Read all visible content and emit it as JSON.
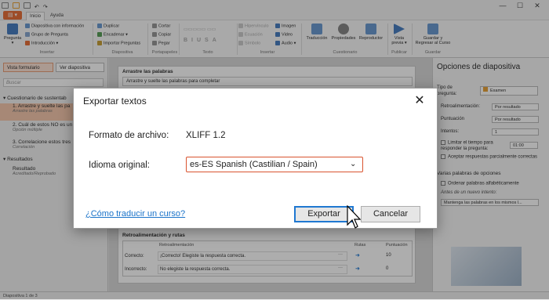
{
  "window": {
    "title": "",
    "min": "—",
    "max": "☐",
    "close": "✕"
  },
  "tabs": {
    "file": "▤ ▾",
    "items": [
      "Inicio",
      "Ayuda"
    ],
    "active": "Inicio"
  },
  "ribbon": {
    "preguntas": {
      "label": "Pregunta",
      "arrow": "▾"
    },
    "insertar_items": [
      "Diapositiva con información",
      "Grupo de Pregunta",
      "Introducción ▾"
    ],
    "insertar": "Insertar",
    "diapositiva_items": [
      "Duplicar",
      "Encadenar ▾",
      "Importar Preguntas"
    ],
    "diapositiva": "Diapositiva",
    "portapapeles_items": [
      "Cortar",
      "Copiar",
      "Pegar"
    ],
    "portapapeles": "Portapapeles",
    "texto": "Texto",
    "insertar2_items": [
      "Hipervínculo",
      "Ecuación",
      "Símbolo"
    ],
    "insertar2_media": [
      "Imagen",
      "Video",
      "Audio ▾"
    ],
    "insertar2": "Insertar",
    "cuestionario_items": [
      "Traducción",
      "Propiedades",
      "Reproductor"
    ],
    "cuestionario": "Cuestionario",
    "publicar_item": "Vista previa ▾",
    "publicar": "Publicar",
    "guardar_item": "Guardar y Regresar al Curso",
    "guardar": "Guardar"
  },
  "left": {
    "view_form": "Vista formulario",
    "view_slide": "Ver diapositiva",
    "search_placeholder": "Buscar",
    "group1": "Cuestionario de sustentab",
    "items": [
      {
        "title": "1. Arrastre y suelte las pa",
        "sub": "Arrastre las palabras"
      },
      {
        "title": "2. Cuál de estos NO es un",
        "sub": "Opción múltiple"
      },
      {
        "title": "3. Correlacione estos tres",
        "sub": "Correlación"
      }
    ],
    "group2": "Resultados",
    "result": {
      "title": "Resultado",
      "sub": "Acreditado/Reprobado"
    }
  },
  "slide": {
    "header": "Arrastre las palabras",
    "instruction": "Arrastre y suelte las palabras para completar",
    "feedback_header": "Retroalimentación y rutas",
    "cols": [
      "Retroalimentación",
      "Rutas",
      "Puntuación"
    ],
    "rows": [
      {
        "label": "Correcto:",
        "text": "¡Correcto! Elegiste la respuesta correcta.",
        "dots": "···",
        "arrow": "➜",
        "score": "10"
      },
      {
        "label": "Incorrecto:",
        "text": "No elegiste la respuesta correcta.",
        "dots": "···",
        "arrow": "➜",
        "score": "0"
      }
    ]
  },
  "right": {
    "title": "Opciones de diapositiva",
    "tipo_label": "Tipo de pregunta:",
    "tipo_value": "Examen",
    "retro_label": "Retroalimentación:",
    "retro_value": "Por resultado",
    "punt_label": "Puntuación",
    "punt_value": "Por resultado",
    "intentos_label": "Intentos:",
    "intentos_value": "1",
    "limitar": "Limitar el tiempo para responder la pregunta:",
    "limitar_value": "01:00",
    "aceptar": "Aceptar respuestas parcialmente correctas",
    "varias": "Varias palabras de opciones",
    "ordenar": "Ordenar palabras alfabéticamente",
    "antes": "Antes de un nuevo intento:",
    "antes_value": "Mantenga las palabras en los mismos l..."
  },
  "status": "Diapositiva 1 de 3",
  "dialog": {
    "title": "Exportar textos",
    "close": "✕",
    "format_label": "Formato de archivo:",
    "format_value": "XLIFF 1.2",
    "lang_label": "Idioma original:",
    "lang_value": "es-ES Spanish (Castilian / Spain)",
    "link": "¿Cómo traducir un curso?",
    "export": "Exportar",
    "cancel": "Cancelar"
  },
  "colors": {
    "accent": "#e8703a",
    "primary_border": "#1f78d1",
    "select_border": "#d9532f",
    "link": "#1a73c9"
  }
}
